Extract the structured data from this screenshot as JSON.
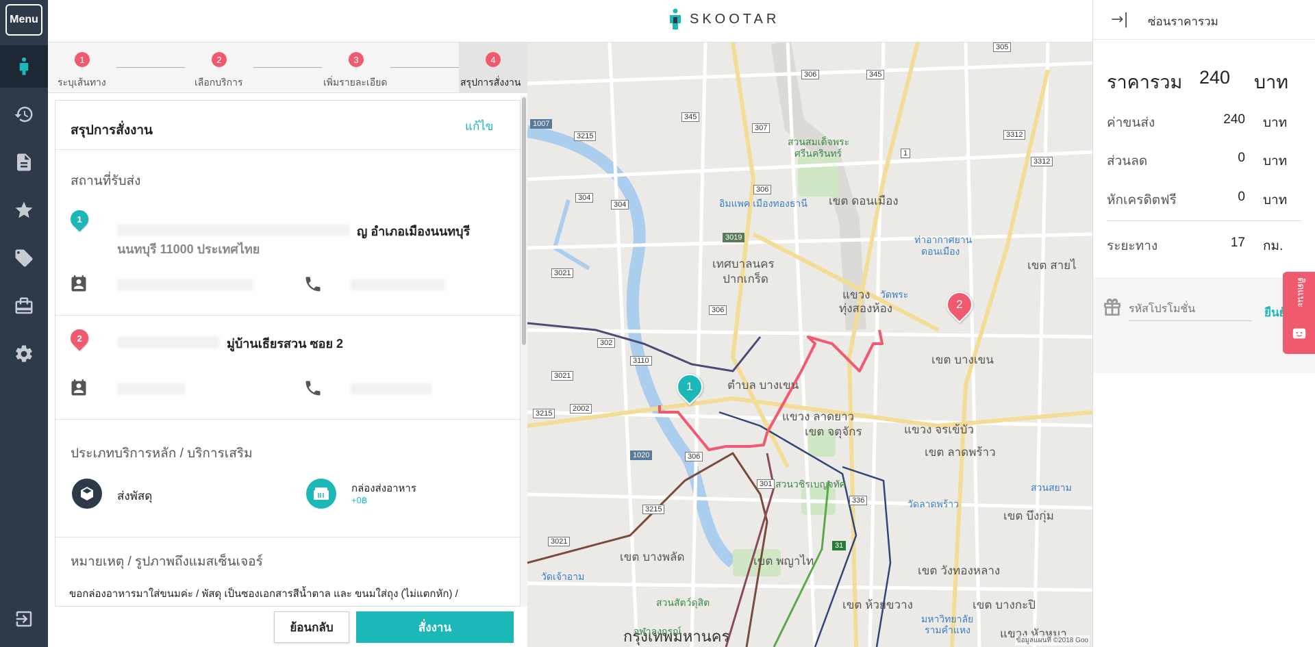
{
  "sidebar": {
    "menu_label": "Menu",
    "items": [
      "skootar-logo-icon",
      "history-icon",
      "document-icon",
      "star-icon",
      "tag-icon",
      "id-card-icon",
      "gear-icon"
    ],
    "bottom_icon": "logout-icon"
  },
  "header": {
    "brand": "SKOOTAR"
  },
  "stepper": {
    "steps": [
      {
        "num": "1",
        "label": "ระบุเส้นทาง"
      },
      {
        "num": "2",
        "label": "เลือกบริการ"
      },
      {
        "num": "3",
        "label": "เพิ่มรายละเอียด"
      },
      {
        "num": "4",
        "label": "สรุปการสั่งงาน"
      }
    ]
  },
  "summary": {
    "title": "สรุปการสั่งงาน",
    "edit_label": "แก้ไข",
    "locations_title": "สถานที่รับส่ง",
    "stop1": {
      "num": "1",
      "address_line1": "ญ อำเภอเมืองนนทบุรี",
      "address_line2": "นนทบุรี 11000 ประเทศไทย"
    },
    "stop2": {
      "num": "2",
      "address_line1": "มู่บ้านเธียรสวน ซอย 2"
    },
    "services_title": "ประเภทบริการหลัก / บริการเสริม",
    "service_main": "ส่งพัสดุ",
    "service_extra": "กล่องส่งอาหาร",
    "service_extra_price": "+0฿",
    "notes_title": "หมายเหตุ / รูปภาพถึงแมสเซ็นเจอร์",
    "notes_text": "ขอกล่องอาหารมาใส่ขนมค่ะ / พัสดุ เป็นซองเอกสารสีน้ำตาล และ ขนมใส่ถุง (ไม่แตกหัก) /"
  },
  "footer": {
    "back_label": "ย้อนกลับ",
    "order_label": "สั่งงาน"
  },
  "map": {
    "pin1": "1",
    "pin2": "2",
    "labels": {
      "l1": "เขต ดอนเมือง",
      "l2": "เทศบาลนคร",
      "l3": "ปากเกร็ด",
      "l4": "แขวง",
      "l5": "ทุ่งสองห้อง",
      "l6": "ตำบล บางเขน",
      "l7": "แขวง ลาดยาว",
      "l8": "เขต จตุจักร",
      "l9": "แขวง จรเข้บัว",
      "l10": "เขต ลาดพร้าว",
      "l11": "เขต บางเขน",
      "l12": "เขต สายไ",
      "l13": "เขต บางพลัด",
      "l14": "เขต พญาไท",
      "l15": "เขต วังทองหลาง",
      "l16": "เขต ห้วยขวาง",
      "l17": "เขต บางกะปิ",
      "l18": "กรุงเทพมหานคร",
      "l19": "แขวง หัวหมา",
      "l20": "เขต บึงกุ่ม"
    },
    "green_labels": {
      "g1": "สวนสมเด็จพระ",
      "g2": "ศรีนครินทร์",
      "g3": "สวนวชิรเบญจทัศ",
      "g4": "สวนสัตว์ดุสิต",
      "g5": "จุฬาลงกรณ์"
    },
    "blue_labels": {
      "b1": "ท่าอากาศยาน",
      "b2": "ดอนเมือง",
      "b3": "อิมแพค เมืองทองธานี",
      "b4": "วัดลาดพร้าว",
      "b5": "วัดเจ้าอาม",
      "b6": "มหาวิทยาลัย",
      "b7": "รามคำแหง",
      "b8": "สวนสยาม",
      "b9": "วัดพระ"
    },
    "shields": {
      "s1": "305",
      "s2": "306",
      "s3": "345",
      "s4": "345",
      "s5": "307",
      "s6": "3215",
      "s7": "1007",
      "s8": "3312",
      "s9": "3312",
      "s10": "304",
      "s11": "304",
      "s12": "306",
      "s13": "3019",
      "s14": "3021",
      "s15": "306",
      "s16": "302",
      "s17": "3110",
      "s18": "3021",
      "s19": "2002",
      "s20": "3215",
      "s21": "1020",
      "s22": "306",
      "s23": "301",
      "s24": "336",
      "s25": "3215",
      "s26": "3021",
      "s27": "31",
      "s28": "1"
    },
    "attribution": "ข้อมูลแผนที่ ©2018 Goo"
  },
  "price": {
    "hide_label": "ซ่อนราคารวม",
    "total_label": "ราคารวม",
    "total_value": "240",
    "currency": "บาท",
    "rows": [
      {
        "label": "ค่าขนส่ง",
        "value": "240",
        "unit": "บาท"
      },
      {
        "label": "ส่วนลด",
        "value": "0",
        "unit": "บาท"
      },
      {
        "label": "หักเครดิตฟรี",
        "value": "0",
        "unit": "บาท"
      }
    ],
    "distance_label": "ระยะทาง",
    "distance_value": "17",
    "distance_unit": "กม.",
    "promo_placeholder": "รหัสโปรโมชั่น",
    "promo_confirm": "ยืนยั"
  },
  "feedback": {
    "label": "ติดแนะ"
  },
  "colors": {
    "accent": "#1cb8b8",
    "pink": "#f05a6e",
    "sidebar": "#2e3a4a"
  }
}
